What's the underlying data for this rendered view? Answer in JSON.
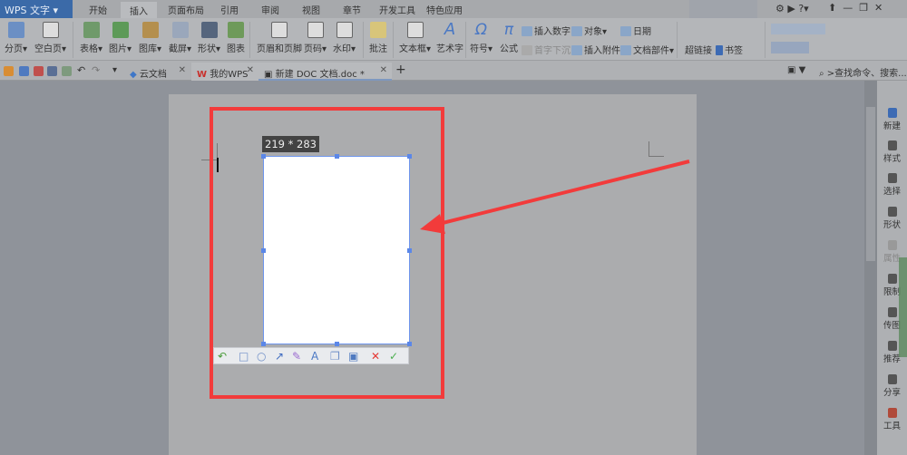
{
  "app": {
    "logo": "WPS 文字"
  },
  "menu_tabs": [
    "开始",
    "插入",
    "页面布局",
    "引用",
    "审阅",
    "视图",
    "章节",
    "开发工具",
    "特色应用"
  ],
  "active_tab": "插入",
  "ribbon": {
    "large": [
      "分页",
      "空白页",
      "表格",
      "图片",
      "图库",
      "截屏",
      "形状",
      "图表",
      "页眉和页脚",
      "页码",
      "水印",
      "批注",
      "文本框",
      "艺术字",
      "符号",
      "公式"
    ],
    "small": [
      "插入数字",
      "对象",
      "日期",
      "首字下沉",
      "插入附件",
      "文档部件",
      "超链接",
      "书签"
    ]
  },
  "doc_tabs": [
    {
      "label": "云文档"
    },
    {
      "label": "我的WPS"
    },
    {
      "label": "新建 DOC 文档.doc *"
    }
  ],
  "search": {
    "placeholder": ">查找命令、搜索..."
  },
  "screenshot": {
    "size_label": "219 * 283"
  },
  "screenshot_tools": [
    "undo-icon",
    "rectangle-icon",
    "ellipse-icon",
    "arrow-icon",
    "brush-icon",
    "text-icon",
    "copy-icon",
    "save-icon",
    "cancel-icon",
    "confirm-icon"
  ],
  "sidebar": [
    "新建",
    "样式",
    "选择",
    "形状",
    "属性",
    "限制",
    "传图",
    "推荐",
    "分享",
    "工具"
  ],
  "colors": {
    "highlight": "#f23b3b",
    "selection": "#6e95ec"
  }
}
